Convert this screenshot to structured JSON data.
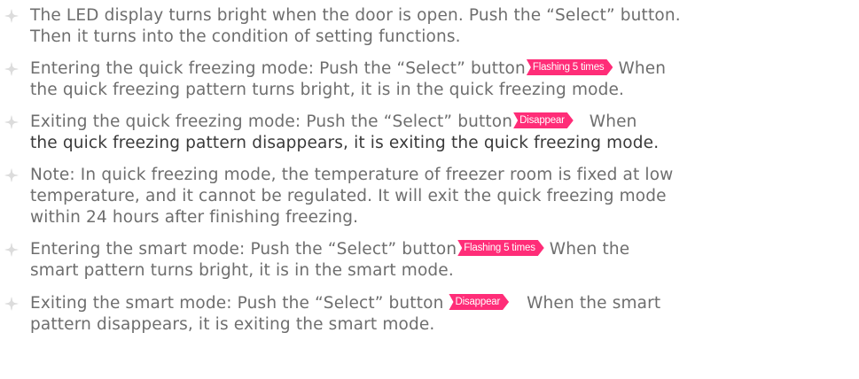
{
  "colors": {
    "text": "#6e6e6e",
    "accent": "#ff2d78",
    "bullet": "#c9c9c9"
  },
  "bullet_icon": "diamond-bullet-icon",
  "items": [
    {
      "lines": [
        "The LED display turns bright when the door is open. Push the “Select” button.",
        "Then it turns into the condition of setting functions."
      ]
    },
    {
      "pre": "Entering the quick freezing mode: Push the “Select” button",
      "arrow": "Flashing 5 times",
      "post": "When",
      "line2": "the quick freezing pattern turns bright, it is in the quick freezing mode."
    },
    {
      "pre": "Exiting the quick freezing mode: Push the “Select” button",
      "arrow": "Disappear",
      "post": "When",
      "line2": "the quick freezing pattern disappears, it is exiting the quick freezing mode."
    },
    {
      "lines": [
        "Note: In quick freezing mode, the temperature of freezer room is fixed at low",
        "temperature, and it cannot be regulated. It will exit the quick freezing mode",
        "within 24 hours after finishing freezing."
      ]
    },
    {
      "pre": "Entering the smart mode: Push the “Select” button",
      "arrow": "Flashing 5 times",
      "post": "When the",
      "line2": "smart pattern turns bright, it is in the smart mode."
    },
    {
      "pre": "Exiting the smart mode: Push the “Select” button",
      "arrow": "Disappear",
      "post": "When the smart",
      "line2": "pattern disappears, it is exiting the smart mode."
    }
  ]
}
